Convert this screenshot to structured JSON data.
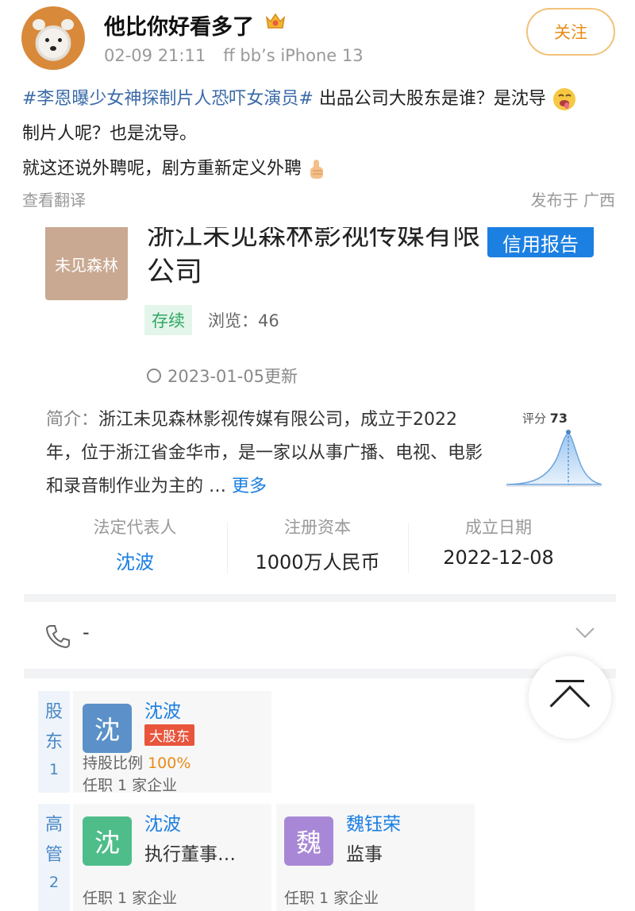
{
  "post": {
    "username": "他比你好看多了",
    "date": "02-09 21:11",
    "device": "ff bb’s iPhone 13",
    "follow_label": "关注",
    "hashtag": "#李恩曝少女神探制片人恐吓女演员#",
    "line1_text": " 出品公司大股东是谁？是沈导",
    "line2_text": "制片人呢？也是沈导。",
    "line3_text": "就这还说外聘呢，剧方重新定义外聘",
    "translate_label": "查看翻译",
    "location": "发布于 广西"
  },
  "company": {
    "logo_text": "未见森林",
    "name": "浙江未见森林影视传媒有限公司",
    "credit_report_label": "信用报告",
    "status": "存续",
    "views": "浏览：46",
    "updated": "2023-01-05更新",
    "intro_label": "简介：",
    "intro_text": "浙江未见森林影视传媒有限公司，成立于2022年，位于浙江省金华市，是一家以从事广播、电视、电影和录音制作业为主的",
    "intro_ellipsis": " …",
    "more_label": "更多",
    "score_label": "评分",
    "score_value": "73",
    "legal_rep_key": "法定代表人",
    "legal_rep_value": "沈波",
    "capital_key": "注册资本",
    "capital_value": "1000万人民币",
    "founded_key": "成立日期",
    "founded_value": "2022-12-08",
    "phone": "-"
  },
  "shareholders": {
    "side_label": "股东",
    "count": "1",
    "person": {
      "avatar_char": "沈",
      "name": "沈波",
      "tag": "大股东",
      "ratio_label": "持股比例",
      "ratio_value": "100%",
      "positions": "任职 1 家企业"
    }
  },
  "executives": {
    "side_label": "高管",
    "count": "2",
    "people": [
      {
        "avatar_char": "沈",
        "name": "沈波",
        "role": "执行董事…",
        "positions": "任职 1 家企业"
      },
      {
        "avatar_char": "魏",
        "name": "魏钰荣",
        "role": "监事",
        "positions": "任职 1 家企业"
      }
    ]
  },
  "colors": {
    "brand_blue": "#1c7fe2",
    "hashtag_blue": "#3a6aa8",
    "follow_orange": "#e98b14",
    "status_green": "#2fa862",
    "shareholder_tag_red": "#e8553c",
    "avatar_blue": "#5b91c8",
    "avatar_green": "#4fbd8a",
    "avatar_purple": "#a888d6"
  }
}
